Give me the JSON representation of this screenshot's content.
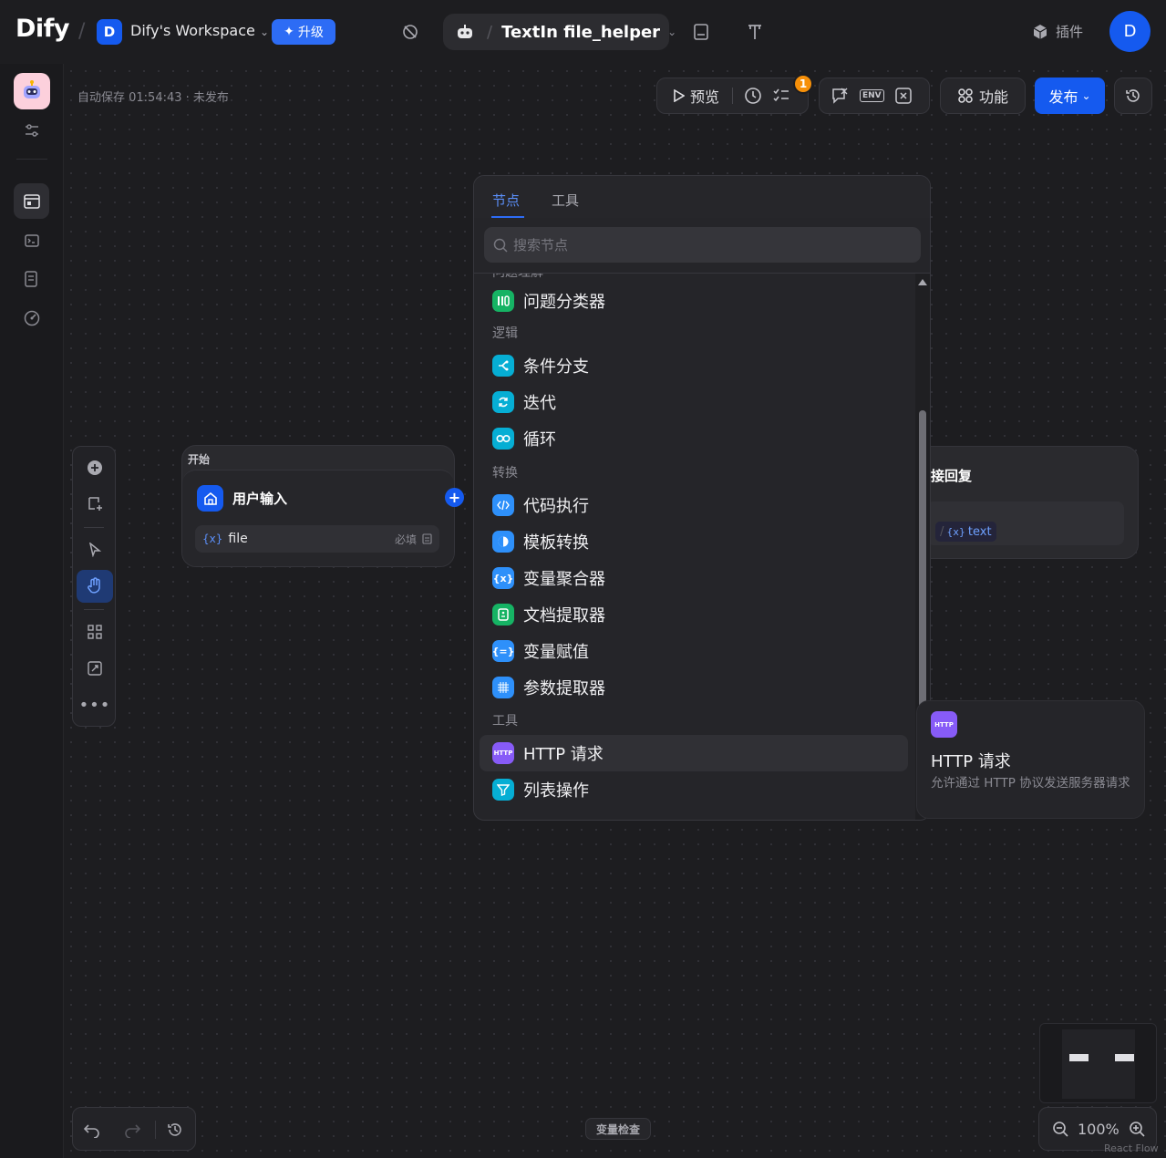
{
  "header": {
    "logo": "Dify",
    "workspace_initial": "D",
    "workspace_name": "Dify's Workspace",
    "upgrade_label": "升级",
    "app_name": "TextIn file_helper",
    "plugins_label": "插件",
    "user_initial": "D"
  },
  "toolbar": {
    "autosave": "自动保存 01:54:43 · 未发布",
    "preview_label": "预览",
    "checklist_count": "1",
    "env_label": "ENV",
    "features_label": "功能",
    "publish_label": "发布"
  },
  "start_node": {
    "header": "开始",
    "title": "用户输入",
    "var_prefix": "{x}",
    "var_name": "file",
    "required": "必填"
  },
  "answer_node": {
    "title": "接回复",
    "var_prefix": "{x}",
    "var_name": "text"
  },
  "panel": {
    "tabs": [
      "节点",
      "工具"
    ],
    "search_placeholder": "搜索节点",
    "partial_group": "问题理解",
    "groups": [
      {
        "title": "逻辑"
      },
      {
        "title": "转换"
      },
      {
        "title": "工具"
      }
    ],
    "items": [
      {
        "label": "问题分类器",
        "icon": "classifier-icon",
        "color": "#16b364"
      },
      {
        "label": "条件分支",
        "icon": "branch-icon",
        "color": "#06aed4"
      },
      {
        "label": "迭代",
        "icon": "iteration-icon",
        "color": "#06aed4"
      },
      {
        "label": "循环",
        "icon": "loop-icon",
        "color": "#06aed4"
      },
      {
        "label": "代码执行",
        "icon": "code-icon",
        "color": "#2e90fa"
      },
      {
        "label": "模板转换",
        "icon": "template-icon",
        "color": "#2e90fa"
      },
      {
        "label": "变量聚合器",
        "icon": "aggregator-icon",
        "color": "#2e90fa"
      },
      {
        "label": "文档提取器",
        "icon": "doc-extractor-icon",
        "color": "#16b364"
      },
      {
        "label": "变量赋值",
        "icon": "assigner-icon",
        "color": "#2e90fa"
      },
      {
        "label": "参数提取器",
        "icon": "param-extractor-icon",
        "color": "#2e90fa"
      },
      {
        "label": "HTTP 请求",
        "icon": "http-icon",
        "color": "#875bf7"
      },
      {
        "label": "列表操作",
        "icon": "list-filter-icon",
        "color": "#06aed4"
      }
    ]
  },
  "tooltip": {
    "title": "HTTP 请求",
    "badge": "HTTP",
    "description": "允许通过 HTTP 协议发送服务器请求"
  },
  "bottom": {
    "var_inspect": "变量检查",
    "zoom": "100%",
    "attribution": "React Flow"
  }
}
